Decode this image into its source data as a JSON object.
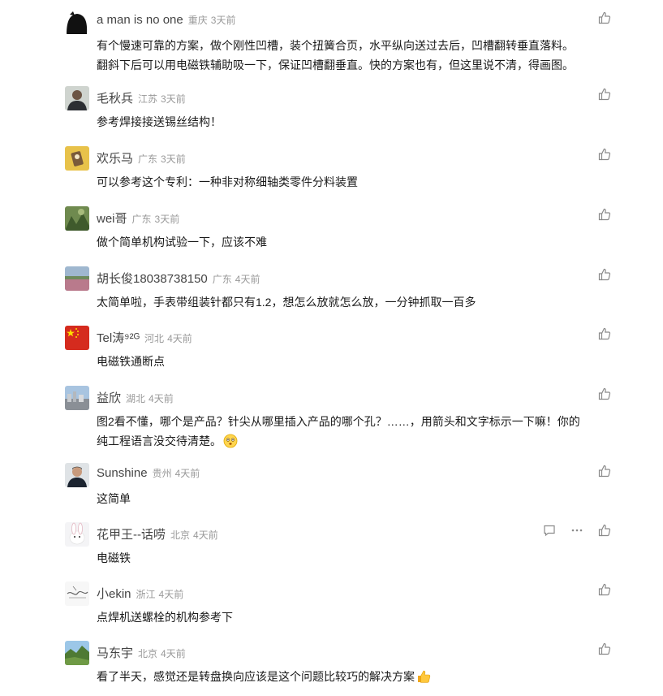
{
  "comments": [
    {
      "author": "a man is no one",
      "location": "重庆",
      "time": "3天前",
      "lines": [
        "有个慢速可靠的方案，做个刚性凹槽，装个扭簧合页，水平纵向送过去后，凹槽翻转垂直落料。",
        "翻斜下后可以用电磁铁辅助吸一下，保证凹槽翻垂直。快的方案也有，但这里说不清，得画图。"
      ]
    },
    {
      "author": "毛秋兵",
      "location": "江苏",
      "time": "3天前",
      "lines": [
        "参考焊接接送锡丝结构！"
      ]
    },
    {
      "author": "欢乐马",
      "location": "广东",
      "time": "3天前",
      "lines": [
        "可以参考这个专利：一种非对称细轴类零件分料装置"
      ]
    },
    {
      "author": "wei哥",
      "location": "广东",
      "time": "3天前",
      "lines": [
        "做个简单机构试验一下，应该不难"
      ]
    },
    {
      "author": "胡长俊18038738150",
      "location": "广东",
      "time": "4天前",
      "lines": [
        "太简单啦，手表带组装针都只有1.2，想怎么放就怎么放，一分钟抓取一百多"
      ]
    },
    {
      "author": "Tel涛⁹²ᴳ",
      "location": "河北",
      "time": "4天前",
      "lines": [
        "电磁铁通断点"
      ]
    },
    {
      "author": "益欣",
      "location": "湖北",
      "time": "4天前",
      "lines": [
        "图2看不懂，哪个是产品？针尖从哪里插入产品的哪个孔？……，用箭头和文字标示一下嘛！你的",
        "纯工程语言没交待清楚。"
      ],
      "emoji": "flushed-face"
    },
    {
      "author": "Sunshine",
      "location": "贵州",
      "time": "4天前",
      "lines": [
        "这简单"
      ]
    },
    {
      "author": "花甲王--话唠",
      "location": "北京",
      "time": "4天前",
      "lines": [
        "电磁铁"
      ]
    },
    {
      "author": "小ekin",
      "location": "浙江",
      "time": "4天前",
      "lines": [
        "点焊机送螺栓的机构参考下"
      ]
    },
    {
      "author": "马东宇",
      "location": "北京",
      "time": "4天前",
      "lines": [
        "看了半天，感觉还是转盘换向应该是这个问题比较巧的解决方案"
      ],
      "emoji": "thumbs-up"
    }
  ],
  "icons": {
    "like": "thumbs-up-icon",
    "reply": "reply-icon",
    "more": "more-icon"
  },
  "colors": {
    "author": "#444444",
    "meta": "#999999",
    "text": "#1a1a1a",
    "icon": "#8a8a8a"
  }
}
